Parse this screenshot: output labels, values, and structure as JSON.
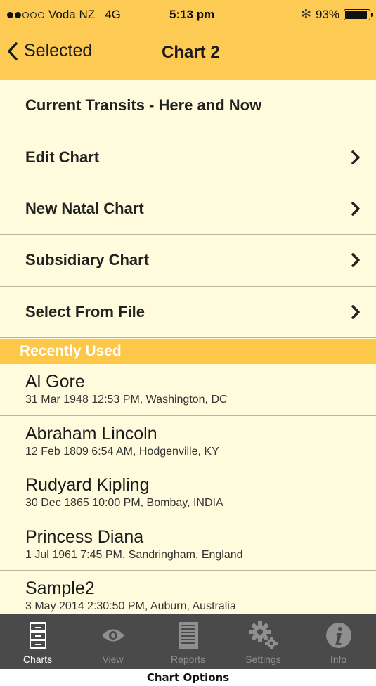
{
  "status_bar": {
    "carrier": "Voda NZ",
    "network": "4G",
    "time": "5:13 pm",
    "battery_text": "93%",
    "battery_level": 0.93,
    "signal_bars_filled": 2,
    "signal_bars_total": 5
  },
  "nav": {
    "back_label": "Selected",
    "title": "Chart 2"
  },
  "menu": [
    {
      "label": "Current Transits - Here and Now",
      "has_chevron": false
    },
    {
      "label": "Edit Chart",
      "has_chevron": true
    },
    {
      "label": "New Natal Chart",
      "has_chevron": true
    },
    {
      "label": "Subsidiary Chart",
      "has_chevron": true
    },
    {
      "label": "Select From File",
      "has_chevron": true
    }
  ],
  "recent": {
    "header": "Recently Used",
    "items": [
      {
        "name": "Al Gore",
        "detail": "31 Mar 1948 12:53 PM, Washington, DC"
      },
      {
        "name": "Abraham Lincoln",
        "detail": "12 Feb 1809 6:54 AM, Hodgenville, KY"
      },
      {
        "name": "Rudyard Kipling",
        "detail": "30 Dec 1865 10:00 PM, Bombay, INDIA"
      },
      {
        "name": "Princess Diana",
        "detail": "1 Jul 1961 7:45 PM, Sandringham, England"
      },
      {
        "name": "Sample2",
        "detail": "3 May 2014 2:30:50 PM, Auburn, Australia"
      }
    ]
  },
  "tabs": [
    {
      "label": "Charts",
      "icon": "file-cabinet-icon",
      "active": true
    },
    {
      "label": "View",
      "icon": "eye-icon",
      "active": false
    },
    {
      "label": "Reports",
      "icon": "document-icon",
      "active": false
    },
    {
      "label": "Settings",
      "icon": "gears-icon",
      "active": false
    },
    {
      "label": "Info",
      "icon": "info-icon",
      "active": false
    }
  ],
  "caption": "Chart Options",
  "colors": {
    "accent": "#fdcb54",
    "background": "#fffbdc",
    "tabbar": "#4a4a4a"
  }
}
